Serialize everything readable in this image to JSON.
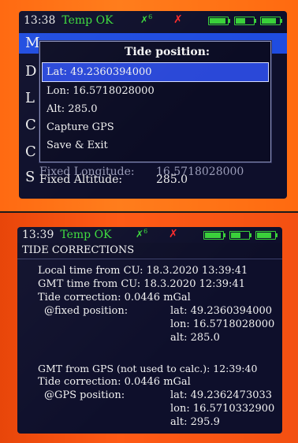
{
  "top_screen": {
    "status": {
      "time": "13:38",
      "state": "Temp OK",
      "sat_count": "6"
    },
    "menu_letters": [
      "M",
      "D",
      "L",
      "C",
      "C",
      "S"
    ],
    "fixed_longitude_label": "Fixed Longitude:",
    "fixed_longitude_value": "16.5718028000",
    "fixed_altitude_label": "Fixed Altitude:",
    "fixed_altitude_value": "285.0",
    "popup": {
      "title": "Tide position:",
      "items": [
        "Lat: 49.2360394000",
        "Lon: 16.5718028000",
        "Alt: 285.0",
        "Capture GPS",
        "Save & Exit"
      ]
    }
  },
  "bottom_screen": {
    "status": {
      "time": "13:39",
      "state": "Temp OK",
      "sat_count": "6"
    },
    "title": "TIDE CORRECTIONS",
    "lines": {
      "local_time": "Local time from CU: 18.3.2020 13:39:41",
      "gmt_time": "GMT time from CU: 18.3.2020 12:39:41",
      "tide_correction_1": "Tide correction: 0.0446 mGal",
      "fixed_position_label": "@fixed position:",
      "fixed_lat": "lat: 49.2360394000",
      "fixed_lon": "lon: 16.5718028000",
      "fixed_alt": "alt: 285.0",
      "gmt_from_gps": "GMT from GPS (not used to calc.): 12:39:40",
      "tide_correction_2": "Tide correction: 0.0446 mGal",
      "gps_position_label": "@GPS position:",
      "gps_lat": "lat: 49.2362473033",
      "gps_lon": "lon: 16.5710332900",
      "gps_alt": "alt: 295.9"
    }
  },
  "colors": {
    "screen_bg": "#0e0f2b",
    "status_green": "#3cdc3c",
    "status_red": "#ff2a2a",
    "highlight_blue": "#2a48d8"
  }
}
